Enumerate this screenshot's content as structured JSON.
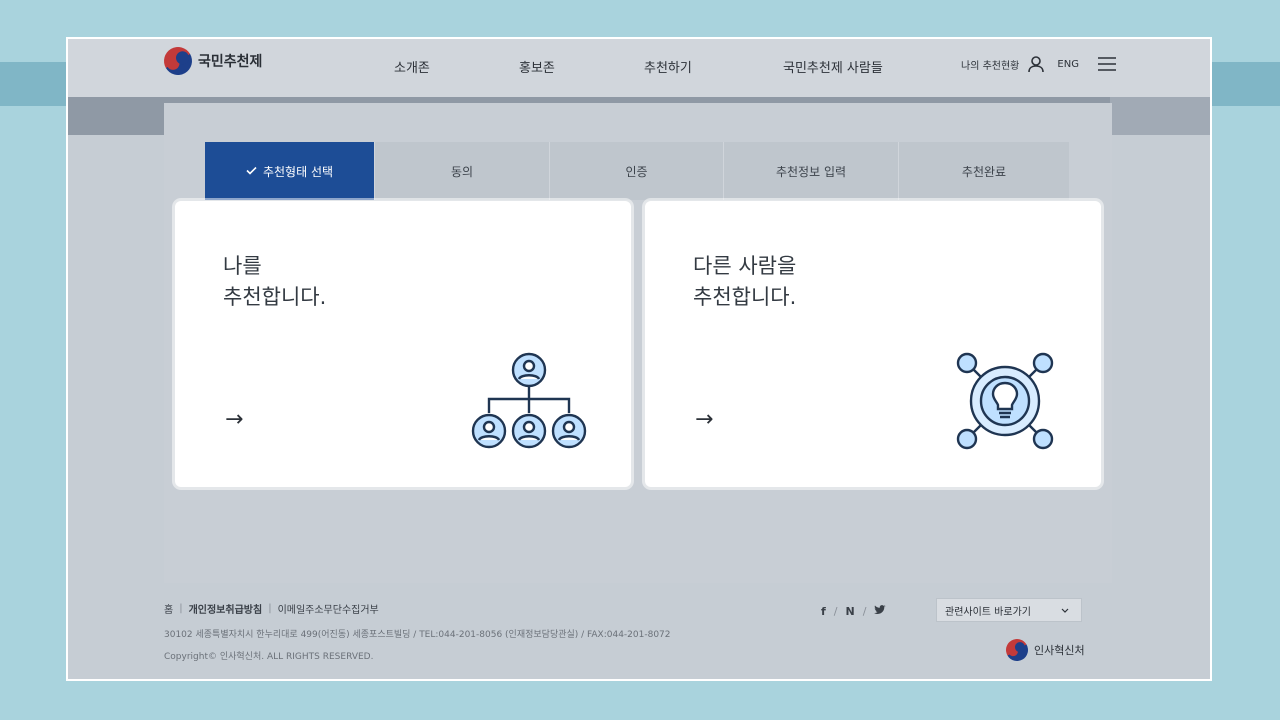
{
  "site": {
    "logo_text": "국민추천제"
  },
  "nav": {
    "items": [
      {
        "label": "소개존"
      },
      {
        "label": "홍보존"
      },
      {
        "label": "추천하기"
      },
      {
        "label": "국민추천제 사람들"
      }
    ]
  },
  "util": {
    "my_status": "나의 추천현황",
    "lang": "ENG"
  },
  "steps": [
    {
      "label": "추천형태 선택",
      "active": true
    },
    {
      "label": "동의"
    },
    {
      "label": "인증"
    },
    {
      "label": "추천정보 입력"
    },
    {
      "label": "추천완료"
    }
  ],
  "cards": [
    {
      "title": "나를\n추천합니다.",
      "arrow": "→",
      "icon": "org-chart-people-icon"
    },
    {
      "title": "다른 사람을\n추천합니다.",
      "arrow": "→",
      "icon": "lightbulb-network-icon"
    }
  ],
  "footer": {
    "links": [
      "홈",
      "개인정보취급방침",
      "이메일주소무단수집거부"
    ],
    "address": "30102 세종특별자치시 한누리대로 499(어진동) 세종포스트빌딩 / TEL:044-201-8056 (인재정보담당관실) / FAX:044-201-8072",
    "copyright": "Copyright© 인사혁신처. ALL RIGHTS RESERVED.",
    "social": [
      "f",
      "N"
    ],
    "related_label": "관련사이트 바로가기",
    "org_name": "인사혁신처"
  },
  "colors": {
    "active_step": "#1d4d96",
    "icon_blue": "#bfe0ff",
    "icon_stroke": "#1f3552"
  }
}
